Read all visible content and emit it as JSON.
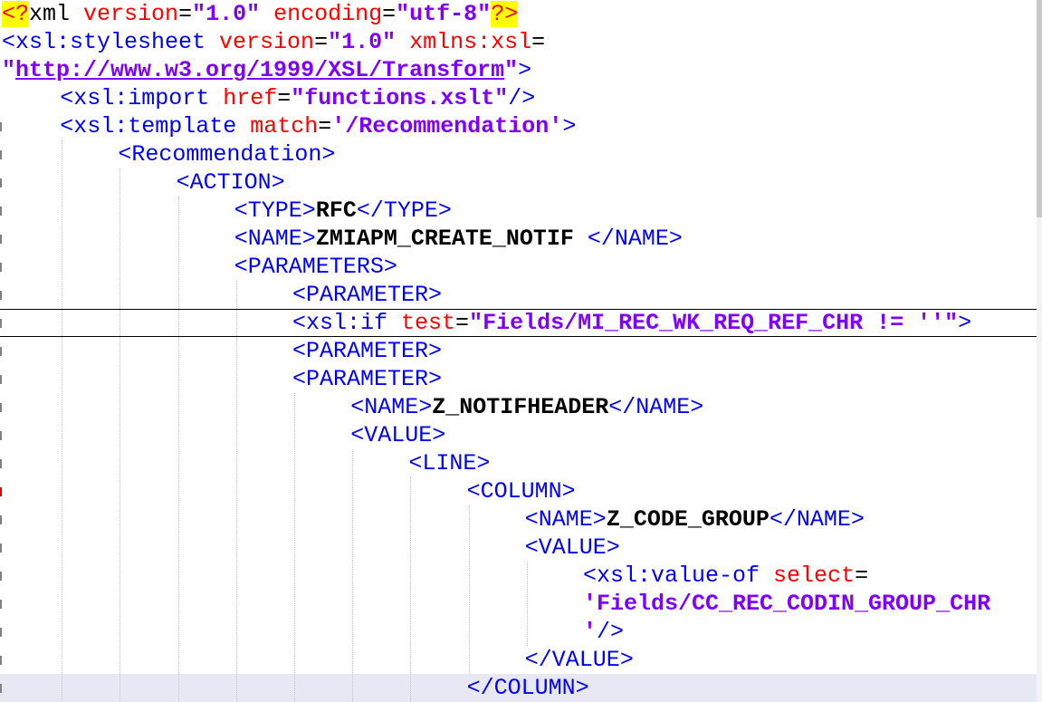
{
  "editor": {
    "lines": [
      {
        "indent": 0,
        "segments": [
          [
            "pi",
            "<?"
          ],
          [
            "p",
            "xml "
          ],
          [
            "a",
            "version"
          ],
          [
            "p",
            "="
          ],
          [
            "v",
            "\"1.0\""
          ],
          [
            "p",
            " "
          ],
          [
            "a",
            "encoding"
          ],
          [
            "p",
            "="
          ],
          [
            "v",
            "\"utf-8\""
          ],
          [
            "pi",
            "?>"
          ]
        ]
      },
      {
        "indent": 0,
        "segments": [
          [
            "t",
            "<xsl:stylesheet "
          ],
          [
            "a",
            "version"
          ],
          [
            "p",
            "="
          ],
          [
            "v",
            "\"1.0\""
          ],
          [
            "p",
            " "
          ],
          [
            "a",
            "xmlns:xsl"
          ],
          [
            "p",
            "="
          ]
        ]
      },
      {
        "indent": 0,
        "segments": [
          [
            "v",
            "\""
          ],
          [
            "vu",
            "http://www.w3.org/1999/XSL/Transform"
          ],
          [
            "v",
            "\""
          ],
          [
            "t",
            ">"
          ]
        ]
      },
      {
        "indent": 1,
        "segments": [
          [
            "t",
            "<xsl:import "
          ],
          [
            "a",
            "href"
          ],
          [
            "p",
            "="
          ],
          [
            "v",
            "\"functions.xslt\""
          ],
          [
            "t",
            "/>"
          ]
        ]
      },
      {
        "indent": 1,
        "segments": [
          [
            "t",
            "<xsl:template "
          ],
          [
            "a",
            "match"
          ],
          [
            "p",
            "="
          ],
          [
            "v",
            "'/Recommendation'"
          ],
          [
            "t",
            ">"
          ]
        ]
      },
      {
        "indent": 2,
        "segments": [
          [
            "t",
            "<Recommendation>"
          ]
        ]
      },
      {
        "indent": 3,
        "segments": [
          [
            "t",
            "<ACTION>"
          ]
        ]
      },
      {
        "indent": 4,
        "segments": [
          [
            "t",
            "<TYPE>"
          ],
          [
            "x",
            "RFC"
          ],
          [
            "t",
            "</TYPE>"
          ]
        ]
      },
      {
        "indent": 4,
        "segments": [
          [
            "t",
            "<NAME>"
          ],
          [
            "x",
            "ZMIAPM_CREATE_NOTIF "
          ],
          [
            "t",
            "</NAME>"
          ]
        ]
      },
      {
        "indent": 4,
        "segments": [
          [
            "t",
            "<PARAMETERS>"
          ]
        ]
      },
      {
        "indent": 5,
        "segments": [
          [
            "t",
            "<PARAMETER>"
          ]
        ]
      },
      {
        "indent": 5,
        "framed": true,
        "segments": [
          [
            "t",
            "<xsl:if "
          ],
          [
            "a",
            "test"
          ],
          [
            "p",
            "="
          ],
          [
            "v",
            "\"Fields/MI_REC_WK_REQ_REF_CHR != ''\""
          ],
          [
            "t",
            ">"
          ]
        ]
      },
      {
        "indent": 5,
        "segments": [
          [
            "t",
            "<PARAMETER>"
          ]
        ]
      },
      {
        "indent": 5,
        "segments": [
          [
            "t",
            "<PARAMETER>"
          ]
        ]
      },
      {
        "indent": 6,
        "segments": [
          [
            "t",
            "<NAME>"
          ],
          [
            "x",
            "Z_NOTIFHEADER"
          ],
          [
            "t",
            "</NAME>"
          ]
        ]
      },
      {
        "indent": 6,
        "segments": [
          [
            "t",
            "<VALUE>"
          ]
        ]
      },
      {
        "indent": 7,
        "segments": [
          [
            "t",
            "<LINE>"
          ]
        ]
      },
      {
        "indent": 8,
        "segments": [
          [
            "t",
            "<COLUMN>"
          ]
        ]
      },
      {
        "indent": 9,
        "segments": [
          [
            "t",
            "<NAME>"
          ],
          [
            "x",
            "Z_CODE_GROUP"
          ],
          [
            "t",
            "</NAME>"
          ]
        ]
      },
      {
        "indent": 9,
        "segments": [
          [
            "t",
            "<VALUE>"
          ]
        ]
      },
      {
        "indent": 10,
        "segments": [
          [
            "t",
            "<xsl:value-of "
          ],
          [
            "a",
            "select"
          ],
          [
            "p",
            "="
          ]
        ]
      },
      {
        "indent": 10,
        "segments": [
          [
            "v",
            "'Fields/CC_REC_CODIN_GROUP_CHR"
          ]
        ]
      },
      {
        "indent": 10,
        "segments": [
          [
            "v",
            "'"
          ],
          [
            "t",
            "/>"
          ]
        ]
      },
      {
        "indent": 9,
        "segments": [
          [
            "t",
            "</VALUE>"
          ]
        ]
      },
      {
        "indent": 8,
        "current": true,
        "segments": [
          [
            "t",
            "</COLUMN>"
          ]
        ]
      }
    ]
  },
  "colors": {
    "tag": "#0000ff",
    "attribute": "#ff0000",
    "value": "#8000ff",
    "text": "#000000",
    "pi_highlight": "#ffff00",
    "current_line": "#e8e8f5"
  }
}
